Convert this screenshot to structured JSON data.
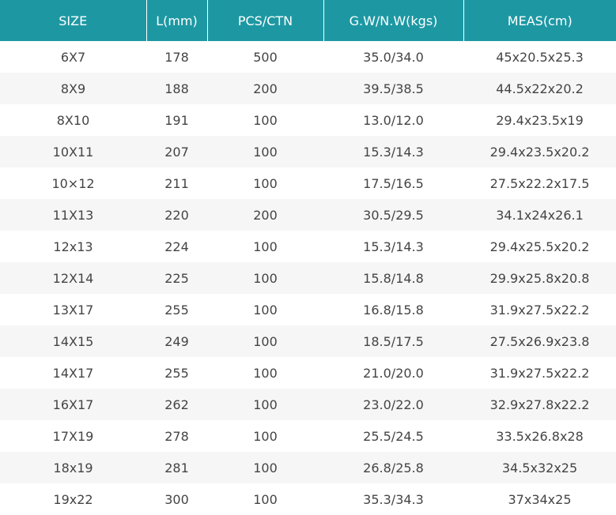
{
  "table": {
    "headers": [
      "SIZE",
      "L(mm)",
      "PCS/CTN",
      "G.W/N.W(kgs)",
      "MEAS(cm)"
    ],
    "rows": [
      [
        "6X7",
        "178",
        "500",
        "35.0/34.0",
        "45x20.5x25.3"
      ],
      [
        "8X9",
        "188",
        "200",
        "39.5/38.5",
        "44.5x22x20.2"
      ],
      [
        "8X10",
        "191",
        "100",
        "13.0/12.0",
        "29.4x23.5x19"
      ],
      [
        "10X11",
        "207",
        "100",
        "15.3/14.3",
        "29.4x23.5x20.2"
      ],
      [
        "10×12",
        "211",
        "100",
        "17.5/16.5",
        "27.5x22.2x17.5"
      ],
      [
        "11X13",
        "220",
        "200",
        "30.5/29.5",
        "34.1x24x26.1"
      ],
      [
        "12x13",
        "224",
        "100",
        "15.3/14.3",
        "29.4x25.5x20.2"
      ],
      [
        "12X14",
        "225",
        "100",
        "15.8/14.8",
        "29.9x25.8x20.8"
      ],
      [
        "13X17",
        "255",
        "100",
        "16.8/15.8",
        "31.9x27.5x22.2"
      ],
      [
        "14X15",
        "249",
        "100",
        "18.5/17.5",
        "27.5x26.9x23.8"
      ],
      [
        "14X17",
        "255",
        "100",
        "21.0/20.0",
        "31.9x27.5x22.2"
      ],
      [
        "16X17",
        "262",
        "100",
        "23.0/22.0",
        "32.9x27.8x22.2"
      ],
      [
        "17X19",
        "278",
        "100",
        "25.5/24.5",
        "33.5x26.8x28"
      ],
      [
        "18x19",
        "281",
        "100",
        "26.8/25.8",
        "34.5x32x25"
      ],
      [
        "19x22",
        "300",
        "100",
        "35.3/34.3",
        "37x34x25"
      ]
    ]
  },
  "colors": {
    "header_bg": "#1d98a3",
    "header_text": "#ffffff",
    "row_alt_bg": "#f6f6f6",
    "cell_text": "#444444"
  }
}
